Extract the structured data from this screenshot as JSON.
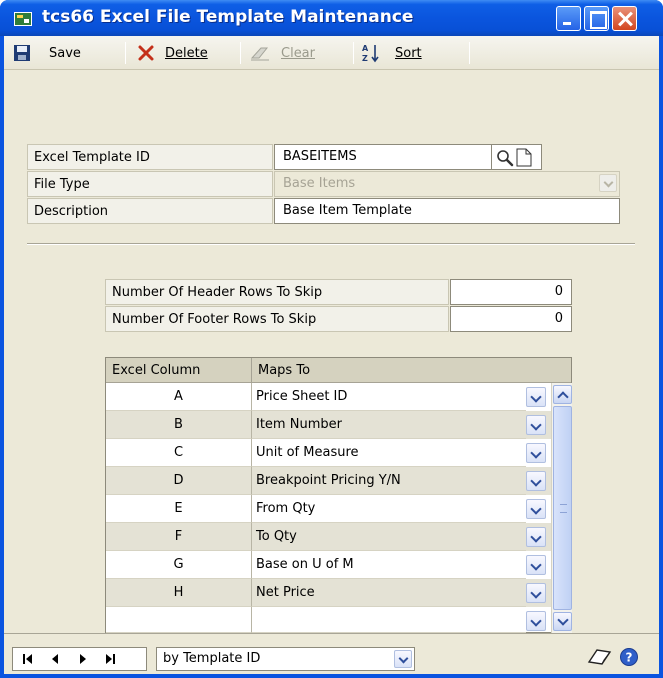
{
  "window": {
    "title": "tcs66 Excel File Template Maintenance"
  },
  "toolbar": {
    "save_label": "Save",
    "delete_label": "Delete",
    "clear_label": "Clear",
    "sort_label": "Sort"
  },
  "form": {
    "template_id_label": "Excel Template ID",
    "template_id_value": "BASEITEMS",
    "file_type_label": "File Type",
    "file_type_value": "Base Items",
    "description_label": "Description",
    "description_value": "Base Item Template",
    "header_rows_label": "Number Of Header Rows To Skip",
    "header_rows_value": "0",
    "footer_rows_label": "Number Of Footer Rows To Skip",
    "footer_rows_value": "0"
  },
  "grid": {
    "columns": [
      "Excel Column",
      "Maps To"
    ],
    "rows": [
      {
        "col": "A",
        "map": "Price Sheet ID"
      },
      {
        "col": "B",
        "map": "Item Number"
      },
      {
        "col": "C",
        "map": "Unit of Measure"
      },
      {
        "col": "D",
        "map": "Breakpoint Pricing Y/N"
      },
      {
        "col": "E",
        "map": "From Qty"
      },
      {
        "col": "F",
        "map": "To Qty"
      },
      {
        "col": "G",
        "map": "Base on U of M"
      },
      {
        "col": "H",
        "map": "Net Price"
      },
      {
        "col": "",
        "map": ""
      }
    ]
  },
  "bottom": {
    "sort_by_value": "by Template ID"
  },
  "icons": [
    "save-icon",
    "delete-icon",
    "clear-icon",
    "sort-icon",
    "lookup-icon",
    "new-note-icon",
    "note-icon",
    "help-icon"
  ]
}
